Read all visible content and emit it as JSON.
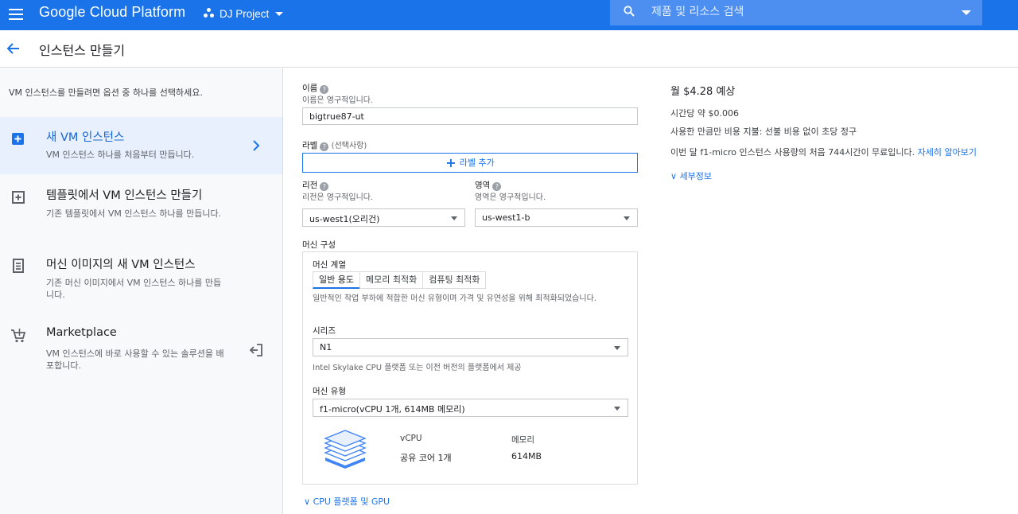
{
  "header": {
    "brand": "Google Cloud Platform",
    "project": "DJ Project",
    "search_placeholder": "제품 및 리소스 검색"
  },
  "title": "인스턴스 만들기",
  "sidebar": {
    "intro": "VM 인스턴스를 만들려면 옵션 중 하나를 선택하세요.",
    "options": [
      {
        "title": "새 VM 인스턴스",
        "desc": "VM 인스턴스 하나를 처음부터 만듭니다."
      },
      {
        "title": "템플릿에서 VM 인스턴스 만들기",
        "desc": "기존 템플릿에서 VM 인스턴스 하나를 만듭니다."
      },
      {
        "title": "머신 이미지의 새 VM 인스턴스",
        "desc": "기존 머신 이미지에서 VM 인스턴스 하나를 만듭니다."
      },
      {
        "title": "Marketplace",
        "desc": "VM 인스턴스에 바로 사용할 수 있는 솔루션을 배포합니다."
      }
    ]
  },
  "form": {
    "name_label": "이름",
    "name_sub": "이름은 영구적입니다.",
    "name_value": "bigtrue87-ut",
    "labels_label": "라벨",
    "labels_optional": "(선택사항)",
    "add_label": "라벨 추가",
    "region_label": "리전",
    "region_sub": "리전은 영구적입니다.",
    "region_value": "us-west1(오리건)",
    "zone_label": "영역",
    "zone_sub": "영역은 영구적입니다.",
    "zone_value": "us-west1-b",
    "machine_config": "머신 구성",
    "machine_family": "머신 계열",
    "tabs": [
      "일반 용도",
      "메모리 최적화",
      "컴퓨팅 최적화"
    ],
    "family_desc": "일반적인 작업 부하에 적합한 머신 유형이며 가격 및 유연성을 위해 최적화되었습니다.",
    "series_label": "시리즈",
    "series_value": "N1",
    "series_desc": "Intel Skylake CPU 플랫폼 또는 이전 버전의 플랫폼에서 제공",
    "machine_type_label": "머신 유형",
    "machine_type_value": "f1-micro(vCPU 1개, 614MB 메모리)",
    "vcpu_header": "vCPU",
    "memory_header": "메모리",
    "vcpu_value": "공유 코어 1개",
    "memory_value": "614MB",
    "cpu_gpu_link": "CPU 플랫폼 및 GPU"
  },
  "pricing": {
    "monthly": "월 $4.28 예상",
    "hourly": "시간당 약 $0.006",
    "sustained": "사용한 만큼만 비용 지불: 선불 비용 없이 초당 정구",
    "free_tier": "이번 달 f1-micro 인스턴스 사용량의 처음 744시간이 무료입니다.",
    "learn_more": "자세히 알아보기",
    "details": "세부정보"
  },
  "colors": {
    "primary": "#1a73e8",
    "active_bg": "#e8f0fe"
  }
}
